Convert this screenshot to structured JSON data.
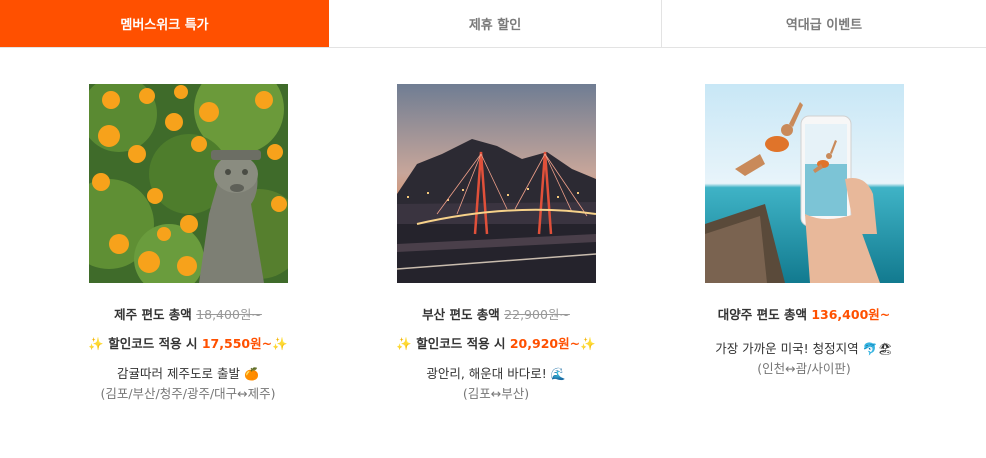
{
  "tabs": [
    {
      "label": "멤버스위크 특가",
      "active": true
    },
    {
      "label": "제휴 할인",
      "active": false
    },
    {
      "label": "역대급 이벤트",
      "active": false
    }
  ],
  "accent_color": "#ff5000",
  "cards": [
    {
      "route": "제주 편도 총액",
      "original_price": "18,400원~",
      "promo_prefix": "할인코드 적용 시",
      "promo_price": "17,550원~",
      "sparkle": "✨",
      "desc": "감귤따러 제주도로 출발",
      "desc_emoji": "🍊",
      "routes": "(김포/부산/청주/광주/대구↔제주)",
      "image_icon": "jeju-tangerine-photo"
    },
    {
      "route": "부산 편도 총액",
      "original_price": "22,900원~",
      "promo_prefix": "할인코드 적용 시",
      "promo_price": "20,920원~",
      "sparkle": "✨",
      "desc": "광안리, 해운대 바다로!",
      "desc_emoji": "🌊",
      "routes": "(김포↔부산)",
      "image_icon": "busan-bridge-photo"
    },
    {
      "route": "대양주 편도 총액",
      "price": "136,400원~",
      "desc": "가장 가까운 미국! 청정지역",
      "desc_emoji": "🐬🏖",
      "routes": "(인천↔괌/사이판)",
      "image_icon": "ocean-jump-photo"
    }
  ]
}
